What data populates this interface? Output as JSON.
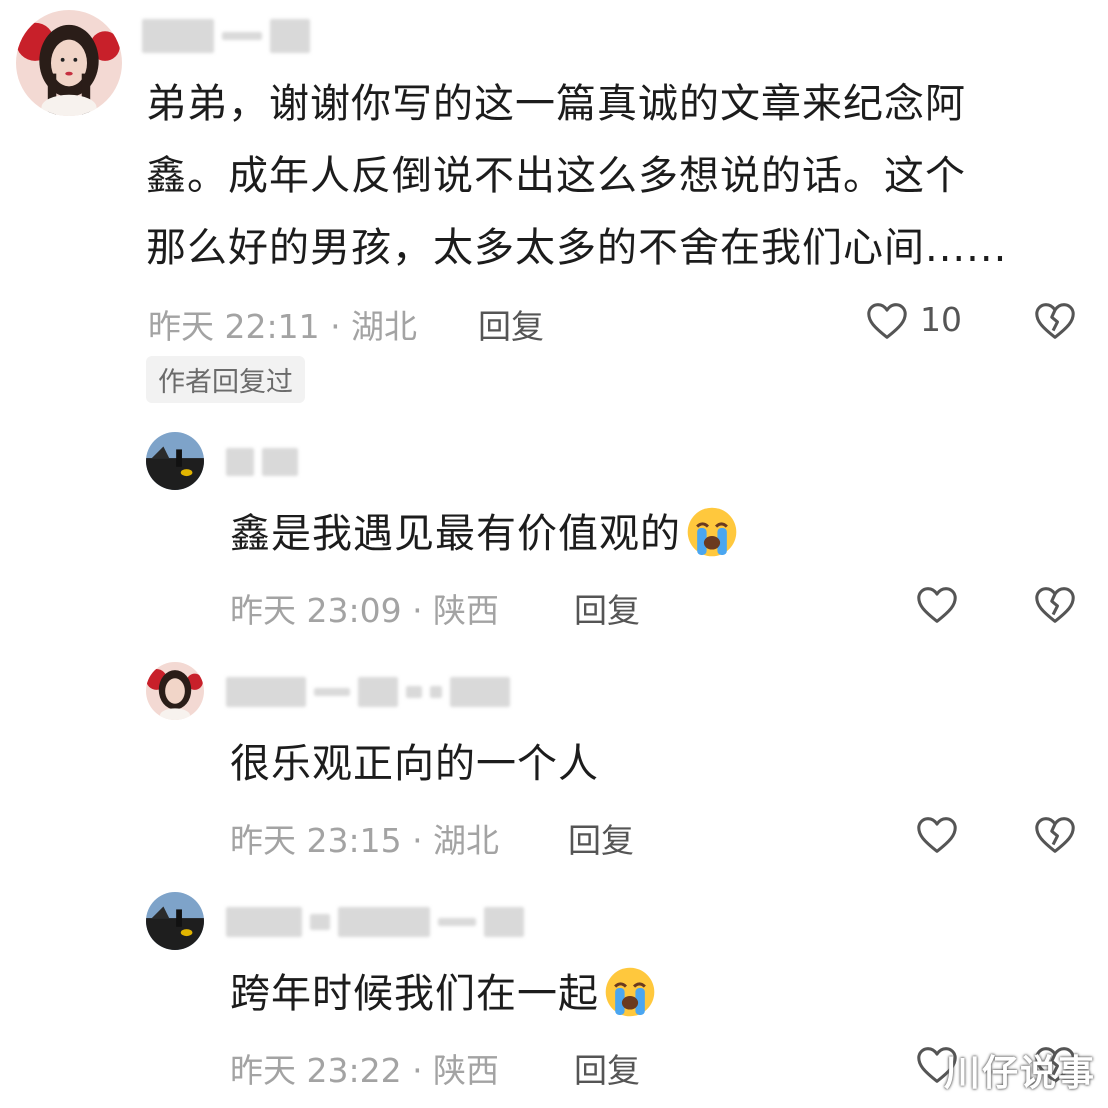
{
  "comments": [
    {
      "lines": [
        "弟弟，谢谢你写的这一篇真诚的文章来纪念阿",
        "鑫。成年人反倒说不出这么多想说的话。这个",
        "那么好的男孩，太多太多的不舍在我们心间......"
      ],
      "meta": "昨天 22:11 · 湖北",
      "reply": "回复",
      "likes": "10",
      "badge": "作者回复过"
    },
    {
      "text": "鑫是我遇见最有价值观的",
      "emoji": "loudly-crying-face",
      "meta": "昨天 23:09 · 陕西",
      "reply": "回复"
    },
    {
      "text": "很乐观正向的一个人",
      "meta": "昨天 23:15 · 湖北",
      "reply": "回复"
    },
    {
      "text": "跨年时候我们在一起",
      "emoji": "loudly-crying-face",
      "meta": "昨天 23:22 · 陕西",
      "reply": "回复"
    }
  ],
  "watermark": "川仔说事",
  "icons": {
    "like": "heart-outline-icon",
    "dislike": "broken-heart-icon"
  }
}
